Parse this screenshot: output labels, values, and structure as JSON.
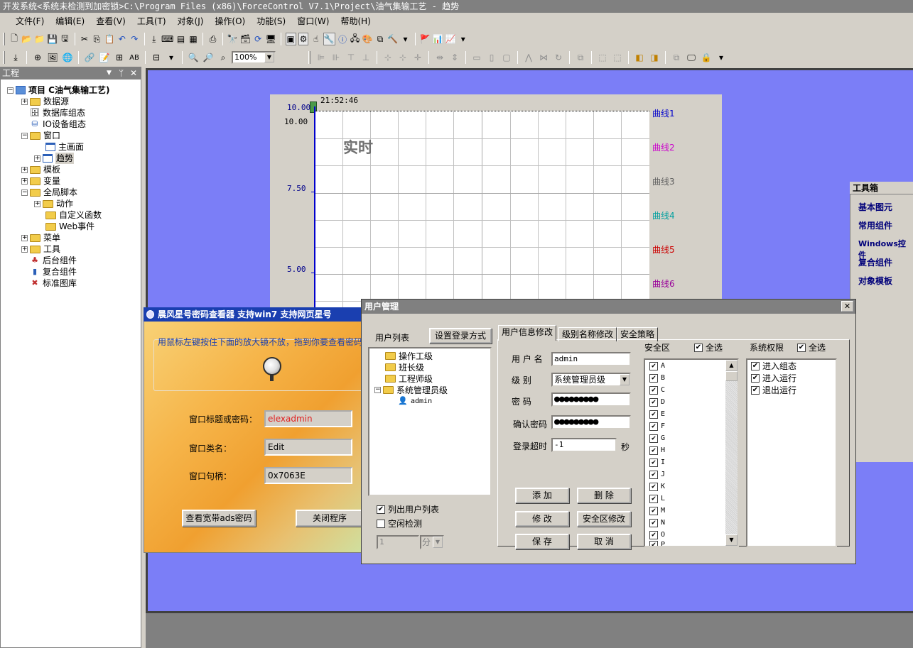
{
  "app": {
    "title": "开发系统<系统未检测到加密锁>C:\\Program Files (x86)\\ForceControl V7.1\\Project\\油气集输工艺 - 趋势"
  },
  "menu": [
    "文件(F)",
    "编辑(E)",
    "查看(V)",
    "工具(T)",
    "对象(J)",
    "操作(O)",
    "功能(S)",
    "窗口(W)",
    "帮助(H)"
  ],
  "toolbar": {
    "zoom": "100%"
  },
  "project": {
    "header": "工程",
    "root": "项目 C油气集输工艺)",
    "items": [
      "数据源",
      "数据库组态",
      "IO设备组态",
      "窗口",
      "主画面",
      "趋势",
      "模板",
      "变量",
      "全局脚本",
      "动作",
      "自定义函数",
      "Web事件",
      "菜单",
      "工具",
      "后台组件",
      "复合组件",
      "标准图库"
    ]
  },
  "trend": {
    "time": "21:52:46",
    "title": "实时",
    "ylabels": [
      "10.00",
      "10.00",
      "7.50",
      "5.00"
    ],
    "curves": [
      "曲线1",
      "曲线2",
      "曲线3",
      "曲线4",
      "曲线5",
      "曲线6"
    ],
    "curve_colors": [
      "#0000cc",
      "#cc00cc",
      "#606060",
      "#00a0a0",
      "#cc0000",
      "#990099"
    ]
  },
  "toolbox": {
    "title": "工具箱",
    "items": [
      "基本图元",
      "常用组件",
      "Windows控件",
      "复合组件",
      "对象模板"
    ]
  },
  "pw": {
    "title": "晨风星号密码查看器 支持win7 支持网页星号",
    "hint": "用鼠标左键按住下面的放大镜不放，拖到你要查看密码",
    "lab_title": "窗口标题或密码：",
    "lab_class": "窗口类名：",
    "lab_handle": "窗口句柄：",
    "val_title": "elexadmin",
    "val_class": "Edit",
    "val_handle": "0x7063E",
    "btn_ads": "查看宽带ads密码",
    "btn_close": "关闭程序"
  },
  "um": {
    "title": "用户管理",
    "close": "✕",
    "userlist_label": "用户列表",
    "login_btn": "设置登录方式",
    "tree": [
      "操作工级",
      "班长级",
      "工程师级",
      "系统管理员级",
      "admin"
    ],
    "chk_list": "列出用户列表",
    "chk_idle": "空闲检测",
    "idle_val": "1",
    "idle_unit": "分",
    "tabs": [
      "用户信息修改",
      "级别名称修改",
      "安全策略"
    ],
    "lab_user": "用 户 名",
    "lab_level": "级   别",
    "lab_pwd": "密   码",
    "lab_confirm": "确认密码",
    "lab_timeout": "登录超时",
    "val_user": "admin",
    "val_level": "系统管理员级",
    "val_pwd": "●●●●●●●●●",
    "val_confirm": "●●●●●●●●●",
    "val_timeout": "-1",
    "unit_sec": "秒",
    "btn_add": "添 加",
    "btn_del": "删 除",
    "btn_mod": "修 改",
    "btn_secmod": "安全区修改",
    "btn_save": "保 存",
    "btn_cancel": "取 消",
    "safety_label": "安全区",
    "selectall": "全选",
    "perm_label": "系统权限",
    "zones": [
      "A",
      "B",
      "C",
      "D",
      "E",
      "F",
      "G",
      "H",
      "I",
      "J",
      "K",
      "L",
      "M",
      "N",
      "O",
      "P"
    ],
    "perms": [
      "进入组态",
      "进入运行",
      "退出运行"
    ]
  }
}
